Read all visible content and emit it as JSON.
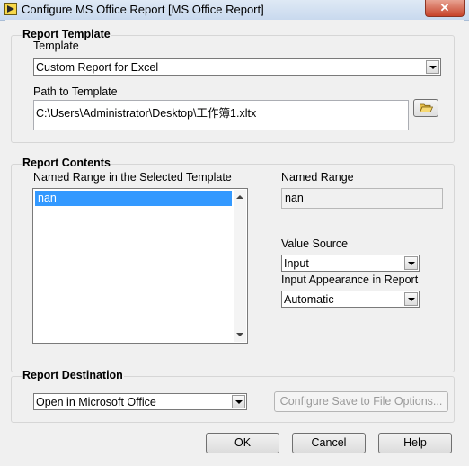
{
  "window": {
    "title": "Configure MS Office Report [MS Office Report]",
    "close_label": "✕",
    "icon": "labview-vi-icon"
  },
  "report_template": {
    "group_title": "Report Template",
    "template_label": "Template",
    "template_value": "Custom Report for Excel",
    "path_label": "Path to Template",
    "path_value": "C:\\Users\\Administrator\\Desktop\\工作簿1.xltx",
    "browse_icon": "folder-open-icon"
  },
  "report_contents": {
    "group_title": "Report Contents",
    "named_range_list_label": "Named Range in the Selected Template",
    "named_range_items": [
      "nan"
    ],
    "named_range_label": "Named Range",
    "named_range_value": "nan",
    "value_source_label": "Value Source",
    "value_source_value": "Input",
    "input_appearance_label": "Input Appearance in Report",
    "input_appearance_value": "Automatic"
  },
  "report_destination": {
    "group_title": "Report Destination",
    "destination_value": "Open in Microsoft Office",
    "configure_save_label": "Configure Save to File Options..."
  },
  "buttons": {
    "ok": "OK",
    "cancel": "Cancel",
    "help": "Help"
  }
}
